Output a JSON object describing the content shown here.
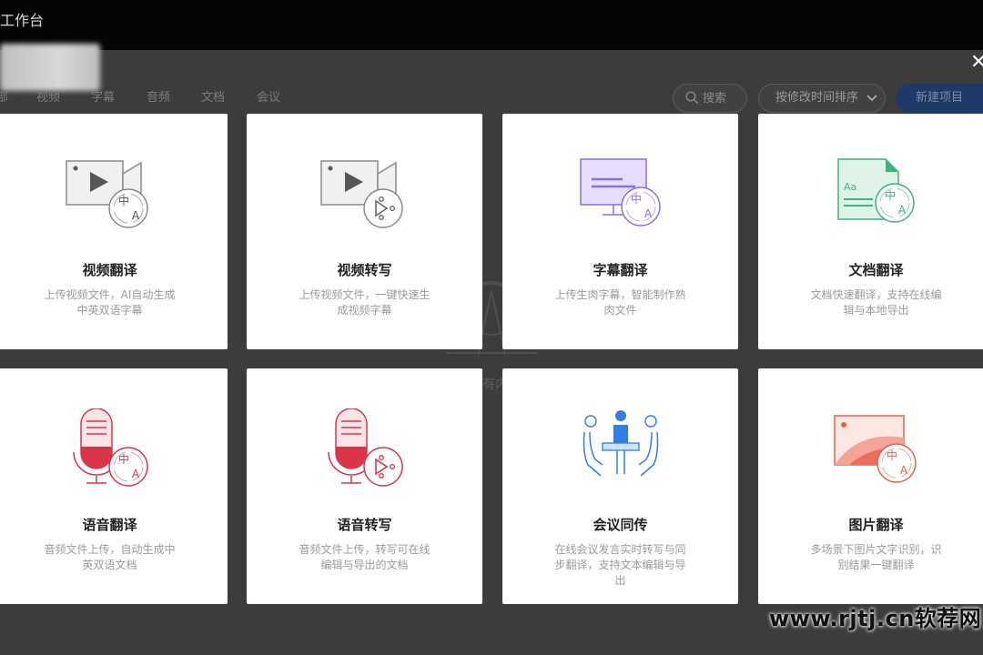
{
  "window": {
    "title": "工作台",
    "close_glyph": "✕"
  },
  "tabs": [
    {
      "label": "部"
    },
    {
      "label": "视频"
    },
    {
      "label": "字幕"
    },
    {
      "label": "音频"
    },
    {
      "label": "文档"
    },
    {
      "label": "会议"
    }
  ],
  "toolbar": {
    "search_placeholder": "搜索",
    "sort_label": "按修改时间排序",
    "new_button": "新建项目"
  },
  "background": {
    "empty_hint": "有内"
  },
  "cards": [
    {
      "title": "视频翻译",
      "desc": "上传视频文件，AI自动生成中英双语字幕",
      "icon": "video-translate-icon"
    },
    {
      "title": "视频转写",
      "desc": "上传视频文件，一键快速生成视频字幕",
      "icon": "video-transcribe-icon"
    },
    {
      "title": "字幕翻译",
      "desc": "上传生肉字幕，智能制作熟肉文件",
      "icon": "subtitle-translate-icon"
    },
    {
      "title": "文档翻译",
      "desc": "文档快速翻译，支持在线编辑与本地导出",
      "icon": "document-translate-icon"
    },
    {
      "title": "语音翻译",
      "desc": "音频文件上传，自动生成中英双语文档",
      "icon": "audio-translate-icon"
    },
    {
      "title": "语音转写",
      "desc": "音频文件上传，转写可在线编辑与导出的文档",
      "icon": "audio-transcribe-icon"
    },
    {
      "title": "会议同传",
      "desc": "在线会议发言实时转写与同步翻译，支持文本编辑与导出",
      "icon": "meeting-interpret-icon"
    },
    {
      "title": "图片翻译",
      "desc": "多场景下图片文字识别，识别结果一键翻译",
      "icon": "image-translate-icon"
    }
  ],
  "icon_badge": {
    "zh": "中",
    "en": "A",
    "aa": "Aa"
  },
  "site_watermark": "www.rjtj.cn软荐网",
  "colors": {
    "video": "#555555",
    "subtitle": "#8a6fe0",
    "document": "#3db57c",
    "audio": "#d9364a",
    "meeting": "#2f7fe6",
    "image": "#e8604a",
    "new_button": "#1d3a66"
  }
}
